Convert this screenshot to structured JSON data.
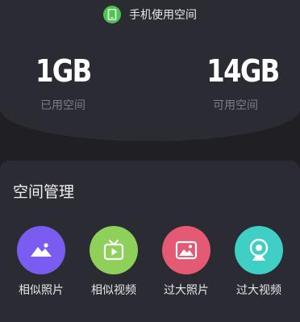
{
  "storage": {
    "title": "手机使用空间",
    "used_value": "1GB",
    "used_label": "已用空间",
    "available_value": "14GB",
    "available_label": "可用空间"
  },
  "space_management": {
    "title": "空间管理",
    "tools": [
      {
        "label": "相似照片",
        "icon": "mountain-photo-icon",
        "color": "#7b5cf0"
      },
      {
        "label": "相似视频",
        "icon": "video-play-icon",
        "color": "#8fd05a"
      },
      {
        "label": "过大照片",
        "icon": "image-icon",
        "color": "#e45a74"
      },
      {
        "label": "过大视频",
        "icon": "camera-icon",
        "color": "#3fcfc4"
      }
    ]
  },
  "colors": {
    "background": "#202024",
    "panel": "#2b2b33",
    "phone_accent": "#4cc64f"
  }
}
